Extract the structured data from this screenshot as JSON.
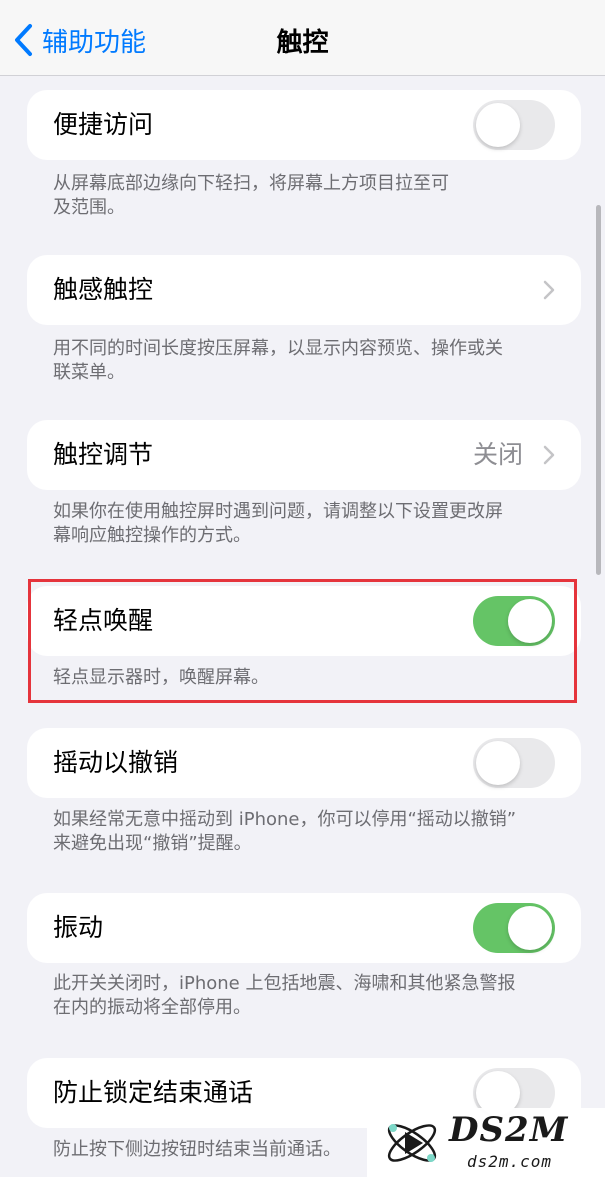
{
  "nav": {
    "back_label": "辅助功能",
    "title": "触控"
  },
  "rows": [
    {
      "label": "便捷访问",
      "control": "toggle",
      "on": false,
      "footer": [
        "从屏幕底部边缘向下轻扫，将屏幕上方项目拉至可",
        "及范围。"
      ]
    },
    {
      "label": "触感触控",
      "control": "chevron",
      "footer": [
        "用不同的时间长度按压屏幕，以显示内容预览、操作或关",
        "联菜单。"
      ]
    },
    {
      "label": "触控调节",
      "control": "chevron",
      "value": "关闭",
      "footer": [
        "如果你在使用触控屏时遇到问题，请调整以下设置更改屏",
        "幕响应触控操作的方式。"
      ]
    },
    {
      "label": "轻点唤醒",
      "control": "toggle",
      "on": true,
      "footer": [
        "轻点显示器时，唤醒屏幕。"
      ]
    },
    {
      "label": "摇动以撤销",
      "control": "toggle",
      "on": false,
      "footer": [
        "如果经常无意中摇动到 iPhone，你可以停用“摇动以撤销”",
        "来避免出现“撤销”提醒。"
      ]
    },
    {
      "label": "振动",
      "control": "toggle",
      "on": true,
      "footer": [
        "此开关关闭时，iPhone 上包括地震、海啸和其他紧急警报",
        "在内的振动将全部停用。"
      ]
    },
    {
      "label": "防止锁定结束通话",
      "control": "toggle",
      "on": false,
      "footer": [
        "防止按下侧边按钮时结束当前通话。"
      ]
    }
  ],
  "watermark": {
    "brand": "DS2M",
    "domain": "ds2m.com"
  },
  "colors": {
    "accent": "#007aff",
    "toggle_on": "#65c466",
    "toggle_off": "#e9e9eb",
    "highlight": "#e5343c"
  }
}
